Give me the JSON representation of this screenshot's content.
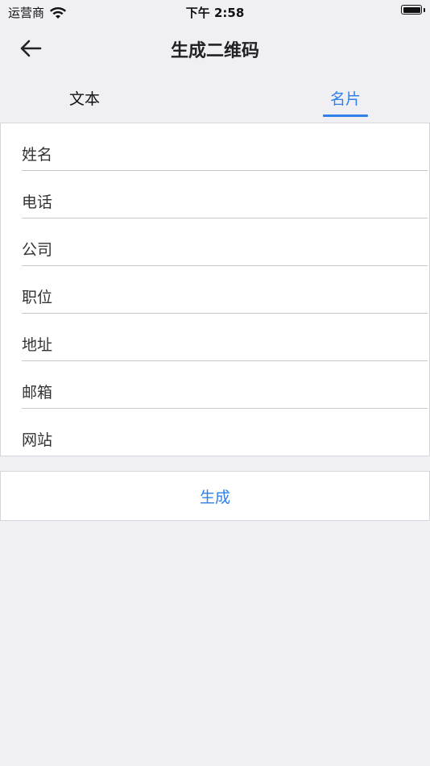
{
  "status_bar": {
    "carrier": "运营商",
    "time": "下午 2:58"
  },
  "nav": {
    "title": "生成二维码",
    "back_icon": "arrow-left-icon"
  },
  "tabs": [
    {
      "label": "文本",
      "selected": false
    },
    {
      "label": "名片",
      "selected": true
    }
  ],
  "form": {
    "fields": [
      {
        "label": "姓名",
        "value": ""
      },
      {
        "label": "电话",
        "value": ""
      },
      {
        "label": "公司",
        "value": ""
      },
      {
        "label": "职位",
        "value": ""
      },
      {
        "label": "地址",
        "value": ""
      },
      {
        "label": "邮箱",
        "value": ""
      },
      {
        "label": "网站",
        "value": ""
      }
    ]
  },
  "generate_button": {
    "label": "生成"
  },
  "colors": {
    "accent": "#2f80e8",
    "background": "#efeff4"
  }
}
